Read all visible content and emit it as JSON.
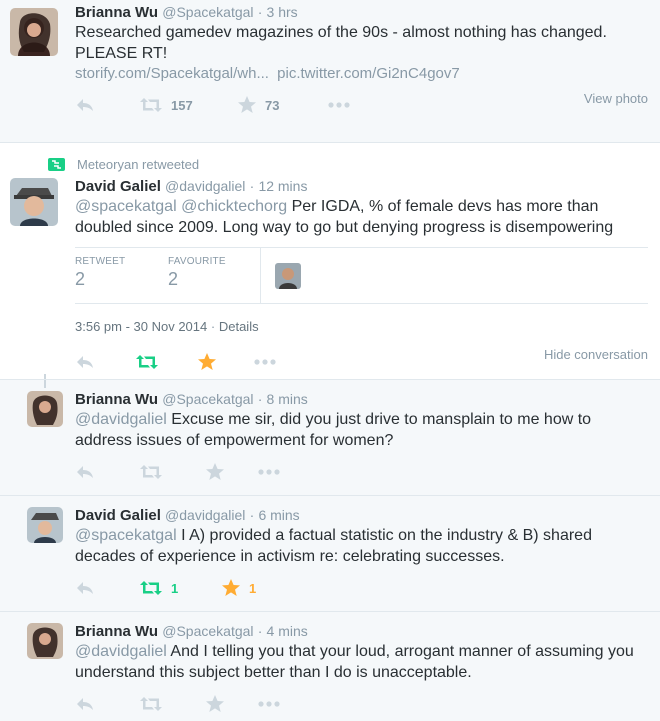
{
  "tweet1": {
    "name": "Brianna Wu",
    "handle": "@Spacekatgal",
    "time": "3 hrs",
    "text": "Researched gamedev magazines of the 90s - almost nothing has changed. PLEASE RT!",
    "link1": "storify.com/Spacekatgal/wh...",
    "link2": "pic.twitter.com/Gi2nC4gov7",
    "retweets": "157",
    "favorites": "73",
    "view_photo": "View photo"
  },
  "tweet2": {
    "retweeted_by": "Meteoryan retweeted",
    "name": "David Galiel",
    "handle": "@davidgaliel",
    "time": "12 mins",
    "mentions": "@spacekatgal @chicktechorg",
    "text": " Per IGDA, % of female devs has more than doubled since 2009. Long way to go but denying progress is disempowering",
    "retweet_label": "RETWEET",
    "retweet_count": "2",
    "favourite_label": "FAVOURITE",
    "favourite_count": "2",
    "timestamp": "3:56 pm - 30 Nov 2014",
    "details": "Details",
    "hide": "Hide conversation"
  },
  "reply1": {
    "name": "Brianna Wu",
    "handle": "@Spacekatgal",
    "time": "8 mins",
    "mention": "@davidgaliel",
    "text": " Excuse me sir, did you just drive to mansplain to me how to address issues of empowerment for women?"
  },
  "reply2": {
    "name": "David Galiel",
    "handle": "@davidgaliel",
    "time": "6 mins",
    "mention": "@spacekatgal",
    "text": " I A) provided a factual statistic on the industry & B) shared decades of experience in activism re: celebrating successes.",
    "retweets": "1",
    "favorites": "1"
  },
  "reply3": {
    "name": "Brianna Wu",
    "handle": "@Spacekatgal",
    "time": "4 mins",
    "mention": "@davidgaliel",
    "text": " And I telling you that your loud, arrogant manner of assuming you understand this subject better than I do is unacceptable."
  },
  "separator": "·",
  "icons": [
    "reply-icon",
    "retweet-icon",
    "favorite-icon",
    "more-icon"
  ],
  "colors": {
    "retweet_active": "#19cf86",
    "favorite_active": "#ffac33",
    "icon_gray": "#ccd6dd"
  }
}
